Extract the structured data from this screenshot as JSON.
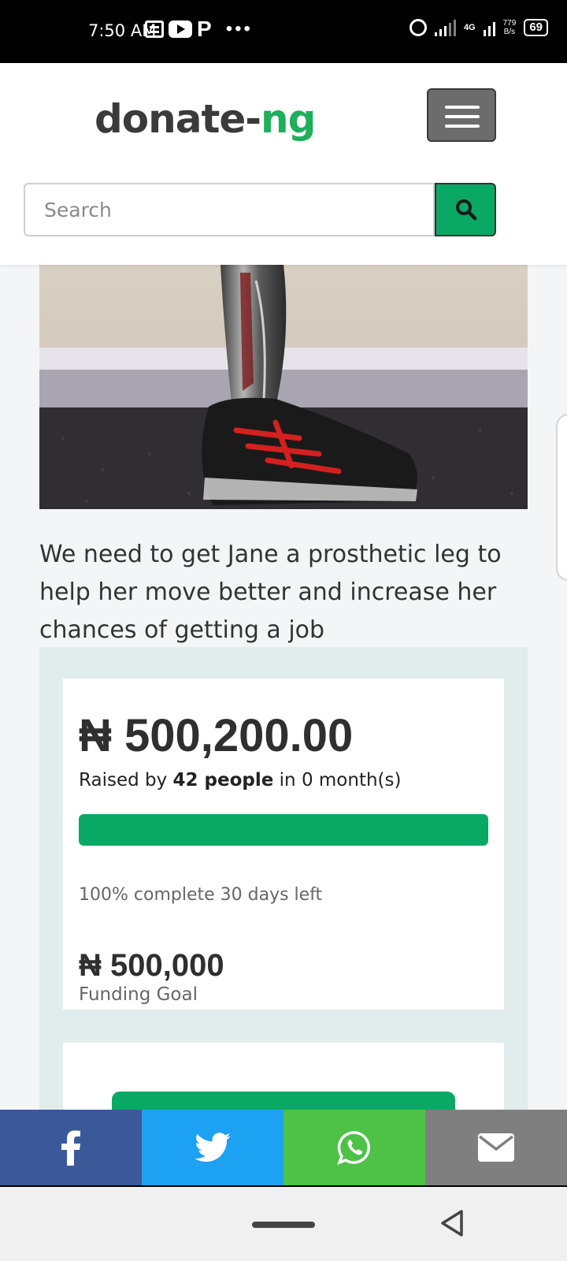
{
  "status_bar": {
    "time": "7:50 AM",
    "network": "4G",
    "speed_value": "779",
    "speed_unit": "B/s",
    "battery": "69"
  },
  "header": {
    "logo_prefix": "donate-",
    "logo_suffix": "ng",
    "search_placeholder": "Search"
  },
  "campaign": {
    "description": "We need to get Jane a prosthetic leg to help her move better and increase her chances of getting a job",
    "amount_raised": "₦ 500,200.00",
    "raised_prefix": "Raised by ",
    "raised_people": "42 people",
    "raised_suffix": " in 0 month(s)",
    "progress_percent": 100,
    "complete_text": "100% complete 30 days left",
    "goal_amount": "₦ 500,000",
    "goal_label": "Funding Goal"
  },
  "share_bar": {
    "items": [
      "facebook",
      "twitter",
      "whatsapp",
      "email"
    ]
  },
  "colors": {
    "brand_green": "#0aa865",
    "facebook": "#3b5998",
    "twitter": "#1da1f2",
    "whatsapp": "#4dc247",
    "email": "#7f7f7f"
  }
}
